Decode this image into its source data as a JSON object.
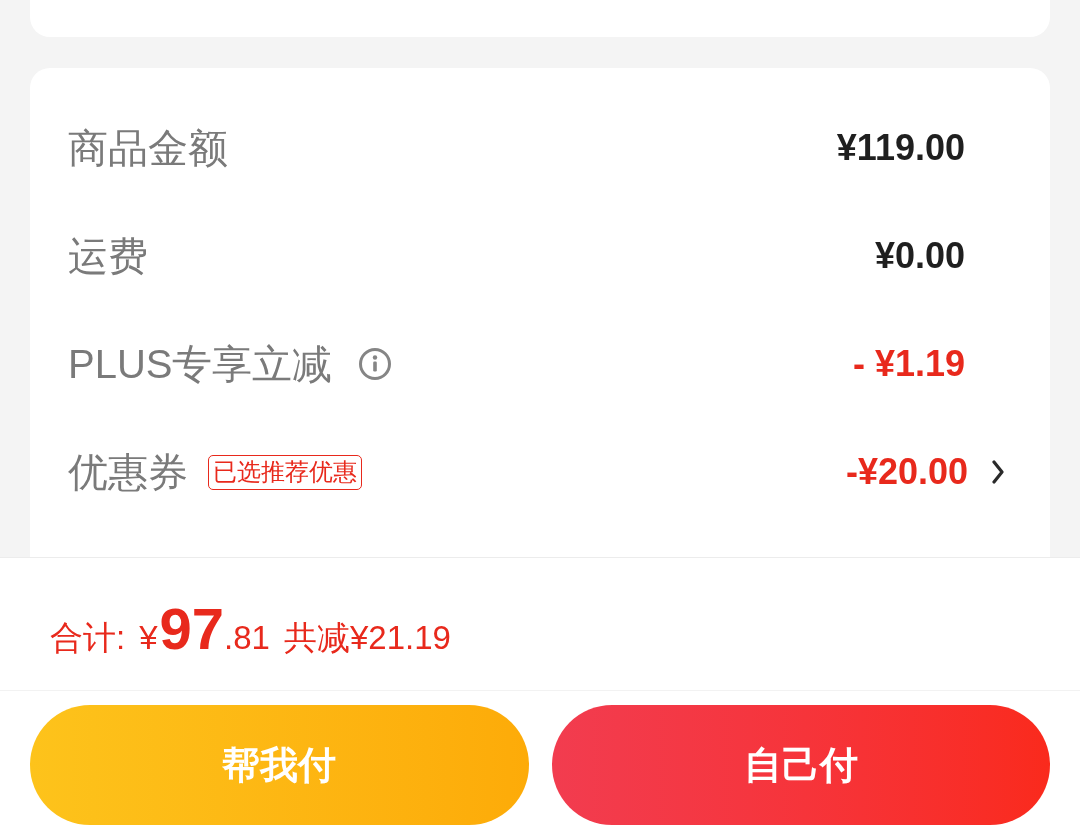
{
  "rows": [
    {
      "kind": "amount",
      "label": "商品金额",
      "value": "¥119.00",
      "info_icon": false,
      "arrow": false
    },
    {
      "kind": "amount",
      "label": "运费",
      "value": "¥0.00",
      "info_icon": false,
      "arrow": false
    },
    {
      "kind": "discount",
      "label": "PLUS专享立减",
      "value": "- ¥1.19",
      "info_icon": true,
      "arrow": false
    },
    {
      "kind": "discount",
      "label": "优惠券",
      "tag": "已选推荐优惠",
      "value": "-¥20.00",
      "info_icon": false,
      "arrow": true
    }
  ],
  "total": {
    "label": "合计:",
    "currency": "¥",
    "integer": "97",
    "decimal": ".81",
    "savings": "共减¥21.19"
  },
  "buttons": [
    {
      "kind": "secondary",
      "label": "帮我付"
    },
    {
      "kind": "primary",
      "label": "自己付"
    }
  ]
}
